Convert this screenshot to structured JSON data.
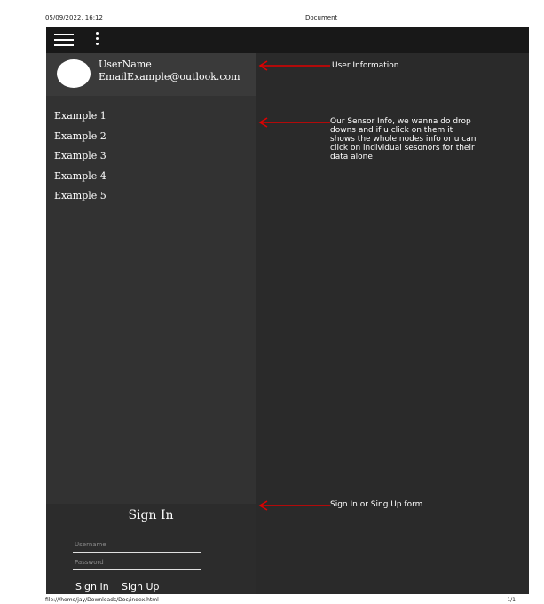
{
  "print_header": {
    "datetime": "05/09/2022, 16:12",
    "title": "Document"
  },
  "print_footer": {
    "path": "file:///home/jay/Downloads/Doc/index.html",
    "page": "1/1"
  },
  "topbar": {
    "menu_icon": "hamburger-menu-icon",
    "more_icon": "vertical-dots-icon"
  },
  "user": {
    "name": "UserName",
    "email": "EmailExample@outlook.com"
  },
  "nav": {
    "items": [
      "Example 1",
      "Example 2",
      "Example 3",
      "Example 4",
      "Example 5"
    ]
  },
  "signin": {
    "title": "Sign In",
    "username_placeholder": "Username",
    "password_placeholder": "Password",
    "signin_label": "Sign In",
    "signup_label": "Sign Up"
  },
  "annotations": {
    "user_info": "User Information",
    "sensor_info": [
      "Our Sensor Info, we wanna do drop",
      "downs and if u click on them  it",
      "shows the whole nodes info or u can",
      "click on individual sesonors for their",
      "data  alone"
    ],
    "form_info": "Sign In or Sing Up form",
    "arrow_color": "#e00000"
  }
}
